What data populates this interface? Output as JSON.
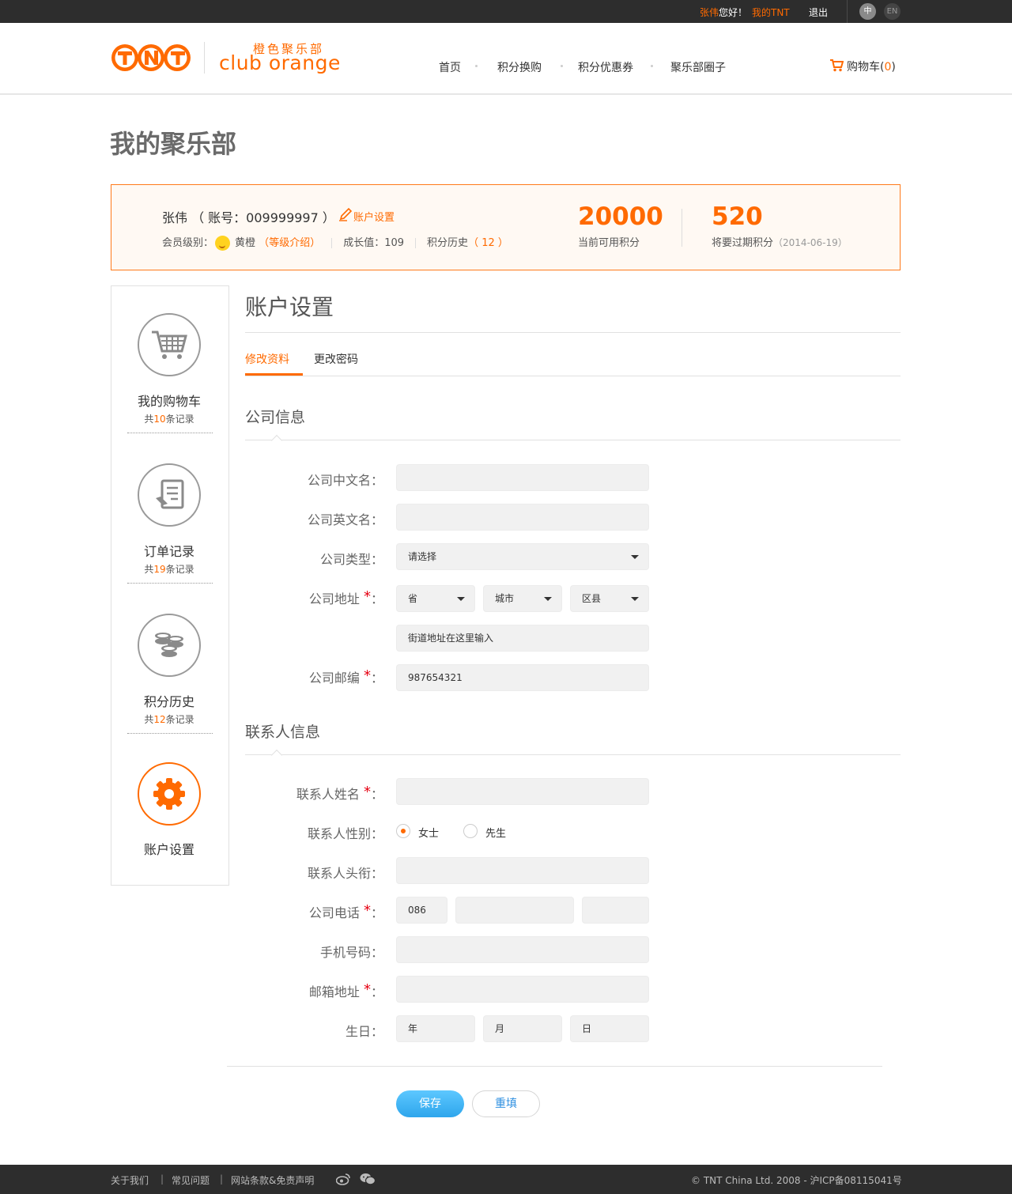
{
  "topbar": {
    "user_name": "张伟",
    "greeting": "您好！",
    "my_tnt": "我的TNT",
    "logout": "退出",
    "lang_zh": "中",
    "lang_en": "EN"
  },
  "header": {
    "logo_cn": "橙色聚乐部",
    "logo_en": "club orange",
    "logo_tnt": "TNT",
    "nav": [
      "首页",
      "积分换购",
      "积分优惠券",
      "聚乐部圈子"
    ],
    "cart_label": "购物车",
    "cart_count": "0"
  },
  "page_title": "我的聚乐部",
  "profile": {
    "name_line": "张伟 （ 账号：009999997 ）",
    "edit_label": "账户设置",
    "level_label": "会员级别：",
    "level_value": "黄橙",
    "level_link": "等级介绍",
    "growth_label": "成长值：109",
    "history_label": "积分历史",
    "history_count": "12",
    "points_available": "20000",
    "points_available_label": "当前可用积分",
    "points_expiring": "520",
    "points_expiring_label": "将要过期积分",
    "expire_date": "2014-06-19"
  },
  "sidebar": {
    "items": [
      {
        "label": "我的购物车",
        "prefix": "共",
        "count": "10",
        "suffix": "条记录"
      },
      {
        "label": "订单记录",
        "prefix": "共",
        "count": "19",
        "suffix": "条记录"
      },
      {
        "label": "积分历史",
        "prefix": "共",
        "count": "12",
        "suffix": "条记录"
      },
      {
        "label": "账户设置"
      }
    ]
  },
  "main": {
    "title": "账户设置",
    "tabs": [
      "修改资料",
      "更改密码"
    ],
    "company_section": "公司信息",
    "contact_section": "联系人信息",
    "fields": {
      "company_cn": {
        "label": "公司中文名：",
        "value": ""
      },
      "company_en": {
        "label": "公司英文名：",
        "value": ""
      },
      "company_type": {
        "label": "公司类型：",
        "value": "请选择"
      },
      "address": {
        "label": "公司地址",
        "province": "省",
        "city": "城市",
        "district": "区县",
        "street": "街道地址在这里输入"
      },
      "zip": {
        "label": "公司邮编",
        "value": "987654321"
      },
      "contact_name": {
        "label": "联系人姓名"
      },
      "gender": {
        "label": "联系人性别：",
        "options": [
          "女士",
          "先生"
        ],
        "selected": "女士"
      },
      "contact_title": {
        "label": "联系人头衔："
      },
      "phone": {
        "label": "公司电话",
        "area_code": "086"
      },
      "mobile": {
        "label": "手机号码："
      },
      "email": {
        "label": "邮箱地址"
      },
      "birthday": {
        "label": "生日：",
        "year": "年",
        "month": "月",
        "day": "日"
      }
    },
    "colon": "：",
    "save": "保存",
    "reset": "重填"
  },
  "footer": {
    "links": [
      "关于我们",
      "常见问题",
      "网站条款&免责声明"
    ],
    "copyright": "© TNT China Ltd. 2008 - 沪ICP备08115041号"
  },
  "colors": {
    "accent": "#ff6a00",
    "dark": "#2d2d2d",
    "button_blue": "#2ea6ec",
    "required": "#e60012"
  }
}
